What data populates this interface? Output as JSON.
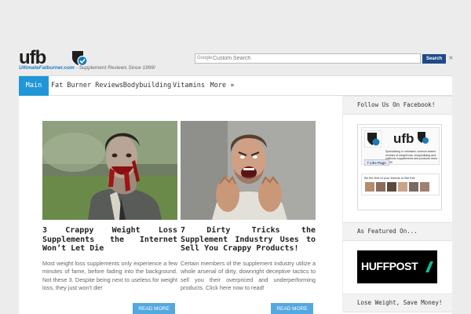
{
  "logo": {
    "wordmark": "ufb",
    "site": "UltimateFatburner.com",
    "tagline": " - Supplement Reviews Since 1999!"
  },
  "search": {
    "brand": "Google",
    "placeholder": "Custom Search",
    "button": "Search",
    "clear": "×"
  },
  "nav": {
    "items": [
      "Main",
      "Fat Burner Reviews",
      "Bodybuilding",
      "Vitamins",
      "More »"
    ],
    "active": 0
  },
  "posts": [
    {
      "title": "3 Crappy Weight Loss Supplements the Internet Won’t Let Die",
      "excerpt": "Most weight loss supplements only experience a few minutes of fame, before fading into the background. Not these 3. Despite being next to useless for weight loss, they just won't die!",
      "read_more": "READ MORE"
    },
    {
      "title": "7 Dirty Tricks the Supplement Industry Uses to Sell You Crappy Products!",
      "excerpt": "Certain members of the supplement industry utilize a whole arsenal of dirty, downright deceptive tactics to sell you their overpriced and underperforming products. Click here now to read!",
      "read_more": "READ MORE"
    }
  ],
  "sidebar": {
    "facebook_title": "Follow Us On Facebook!",
    "fb_description": "Specializing in unbiased, science-based reviews of weight loss, bodybuilding and wellness supplements and products since 1999!",
    "fb_like": "Like Page",
    "fb_friends": "Be the first of your friends to like this",
    "featured_title": "As Featured On...",
    "huffpost": "HUFFPOST",
    "bottom_title": "Lose Weight, Save Money!"
  },
  "colors": {
    "accent": "#2196d6",
    "read_more": "#53a8e0",
    "search_button": "#1e4a88",
    "brand_blue": "#1b7bbd",
    "huffpost_green": "#0dbe98"
  }
}
